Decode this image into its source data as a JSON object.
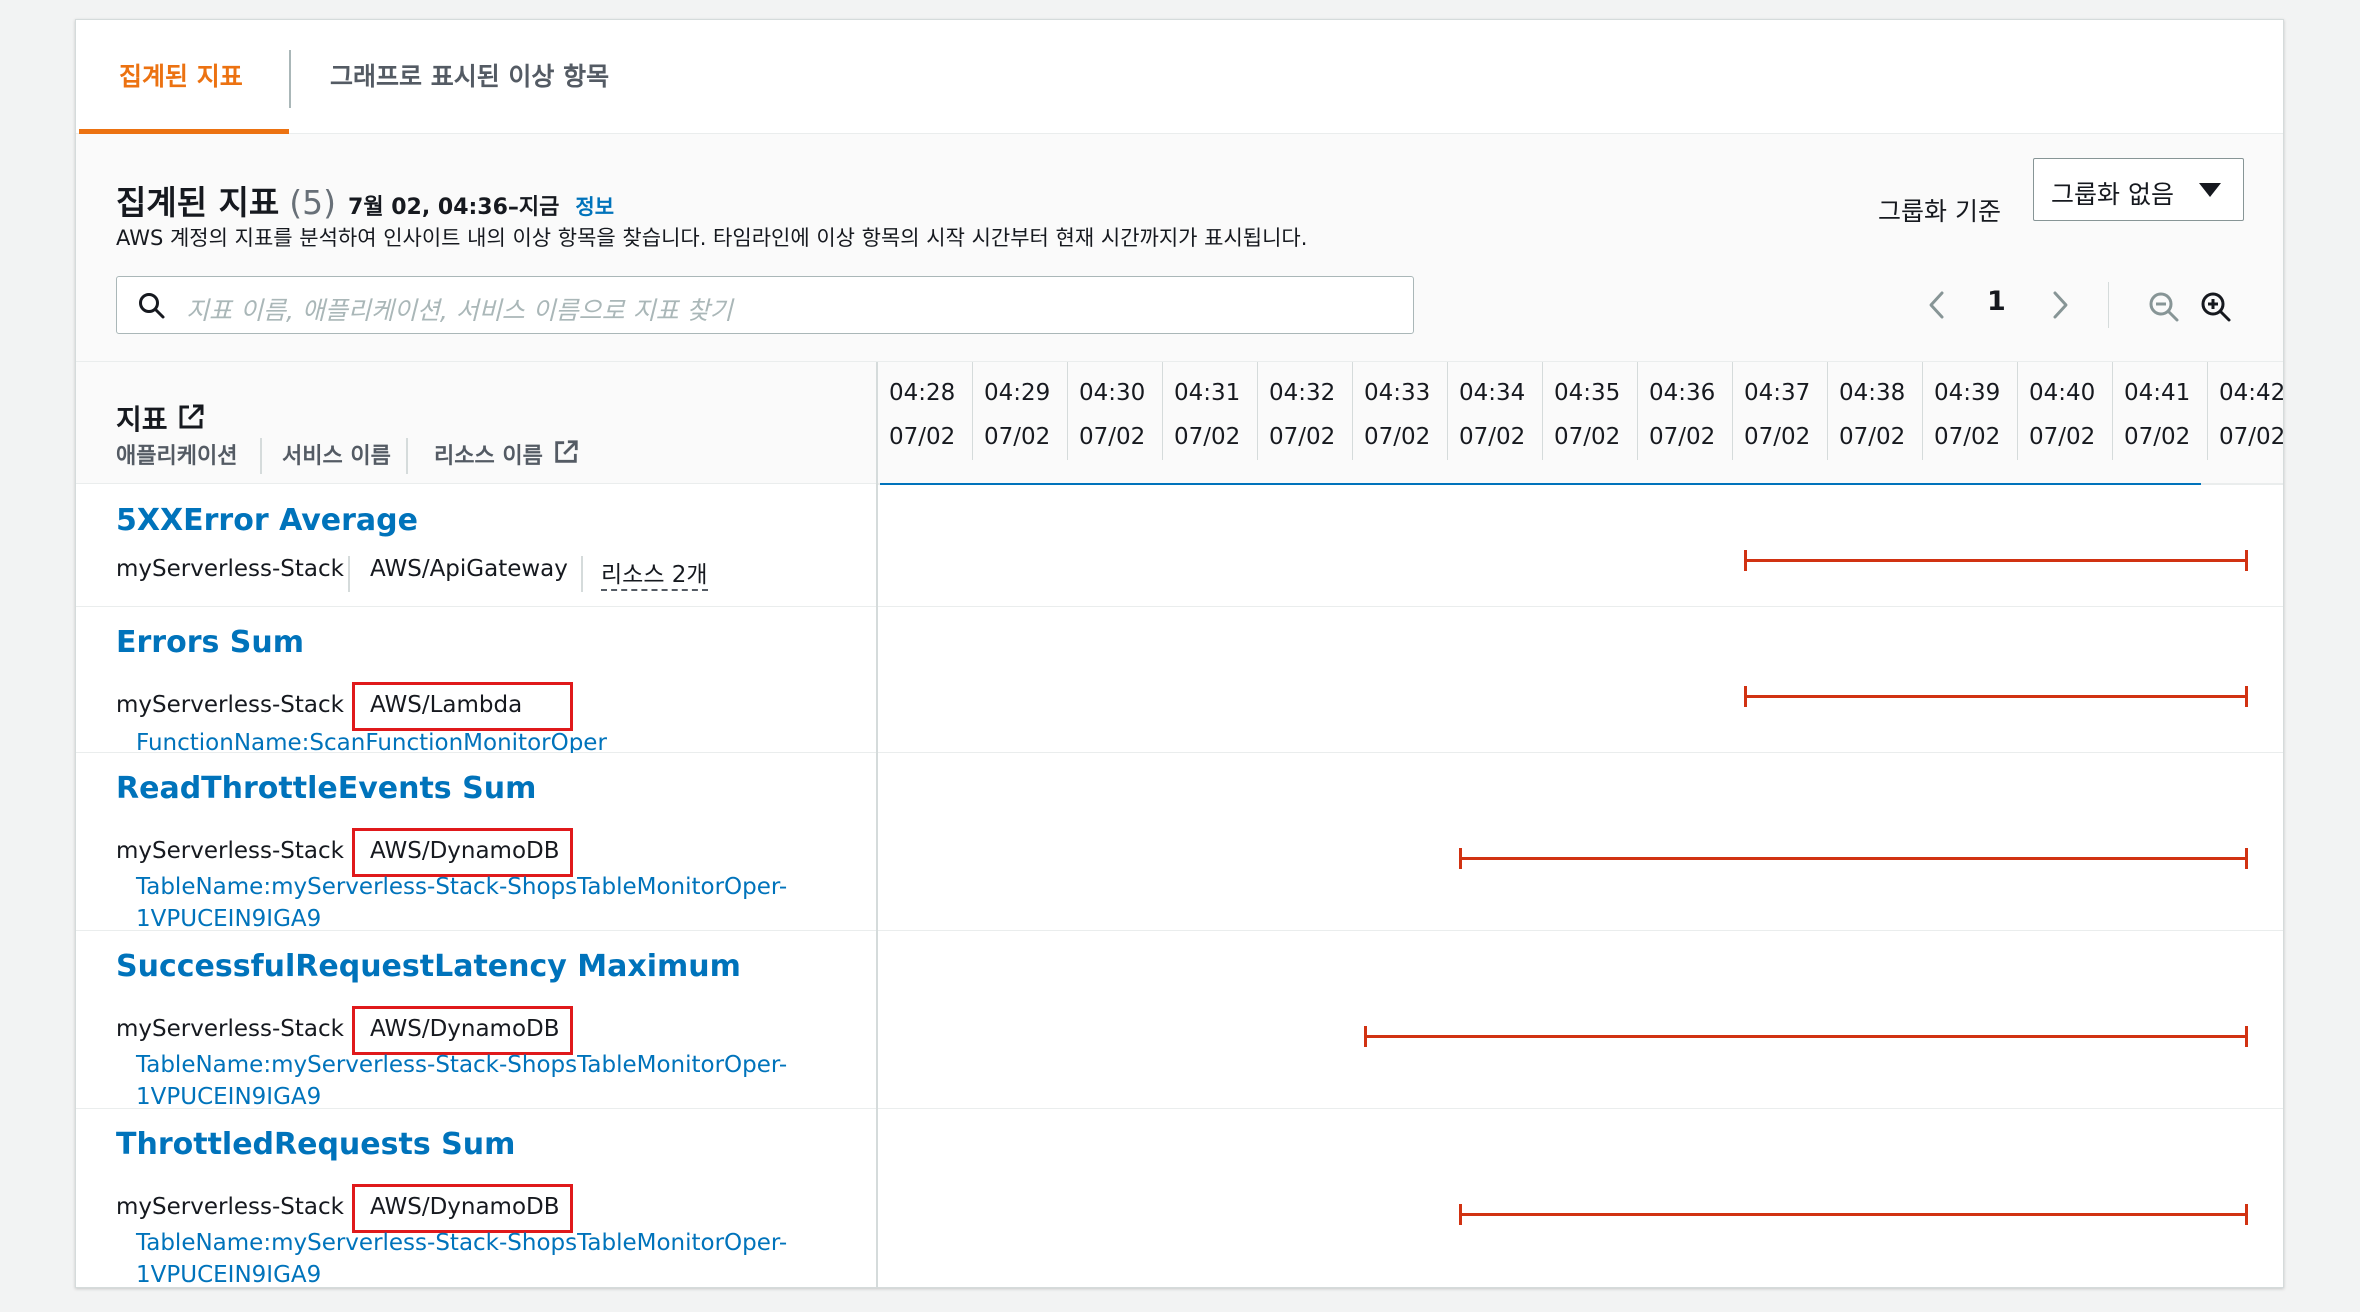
{
  "tabs": [
    {
      "label": "집계된 지표",
      "active": true
    },
    {
      "label": "그래프로 표시된 이상 항목",
      "active": false
    }
  ],
  "header": {
    "title": "집계된 지표",
    "count": "(5)",
    "time_range": "7월 02, 04:36–지금",
    "info": "정보",
    "description": "AWS 계정의 지표를 분석하여 인사이트 내의 이상 항목을 찾습니다. 타임라인에 이상 항목의 시작 시간부터 현재 시간까지가 표시됩니다."
  },
  "group_by": {
    "label": "그룹화 기준",
    "value": "그룹화 없음"
  },
  "search": {
    "placeholder": "지표 이름, 애플리케이션, 서비스 이름으로 지표 찾기"
  },
  "pagination": {
    "current": "1"
  },
  "columns": {
    "metrics": "지표",
    "application": "애플리케이션",
    "service": "서비스 이름",
    "resource": "리소스 이름"
  },
  "timeline": [
    {
      "time": "04:28",
      "date": "07/02"
    },
    {
      "time": "04:29",
      "date": "07/02"
    },
    {
      "time": "04:30",
      "date": "07/02"
    },
    {
      "time": "04:31",
      "date": "07/02"
    },
    {
      "time": "04:32",
      "date": "07/02"
    },
    {
      "time": "04:33",
      "date": "07/02"
    },
    {
      "time": "04:34",
      "date": "07/02"
    },
    {
      "time": "04:35",
      "date": "07/02"
    },
    {
      "time": "04:36",
      "date": "07/02"
    },
    {
      "time": "04:37",
      "date": "07/02"
    },
    {
      "time": "04:38",
      "date": "07/02"
    },
    {
      "time": "04:39",
      "date": "07/02"
    },
    {
      "time": "04:40",
      "date": "07/02"
    },
    {
      "time": "04:41",
      "date": "07/02"
    },
    {
      "time": "04:42",
      "date": "07/02"
    }
  ],
  "rows": [
    {
      "name": "5XXError Average",
      "application": "myServerless-Stack",
      "service": "AWS/ApiGateway",
      "resources": "리소스 2개",
      "anomaly_start": "04:37",
      "anomaly_end": "04:42"
    },
    {
      "name": "Errors Sum",
      "application": "myServerless-Stack",
      "service": "AWS/Lambda",
      "resource": "FunctionName:ScanFunctionMonitorOper",
      "anomaly_start": "04:37",
      "anomaly_end": "04:42"
    },
    {
      "name": "ReadThrottleEvents Sum",
      "application": "myServerless-Stack",
      "service": "AWS/DynamoDB",
      "resource_line1": "TableName:myServerless-Stack-ShopsTableMonitorOper-",
      "resource_line2": "1VPUCEIN9IGA9",
      "anomaly_start": "04:34",
      "anomaly_end": "04:42"
    },
    {
      "name": "SuccessfulRequestLatency Maximum",
      "application": "myServerless-Stack",
      "service": "AWS/DynamoDB",
      "resource_line1": "TableName:myServerless-Stack-ShopsTableMonitorOper-",
      "resource_line2": "1VPUCEIN9IGA9",
      "anomaly_start": "04:33",
      "anomaly_end": "04:42"
    },
    {
      "name": "ThrottledRequests Sum",
      "application": "myServerless-Stack",
      "service": "AWS/DynamoDB",
      "resource_line1": "TableName:myServerless-Stack-ShopsTableMonitorOper-",
      "resource_line2": "1VPUCEIN9IGA9",
      "anomaly_start": "04:34",
      "anomaly_end": "04:42"
    }
  ],
  "colors": {
    "accent": "#ec7211",
    "link": "#0073bb",
    "anomaly": "#d13212",
    "highlight_box": "#e0191b"
  }
}
